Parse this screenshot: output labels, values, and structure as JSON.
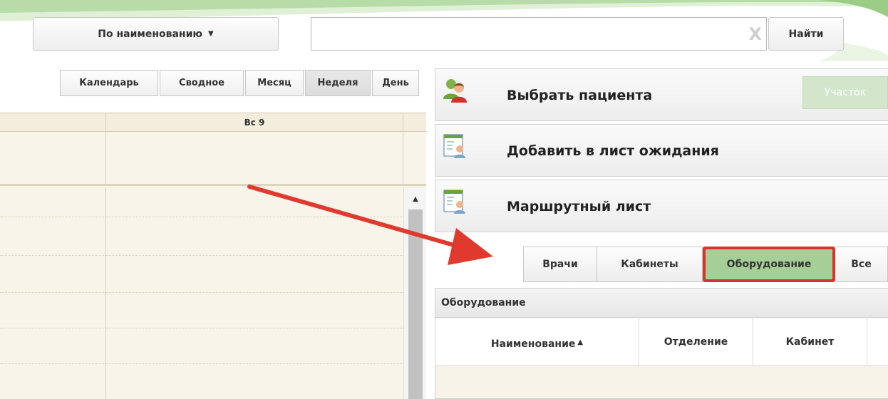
{
  "toolbar": {
    "search_by_label": "По наименованию",
    "search_placeholder": "",
    "search_value": "",
    "find_label": "Найти"
  },
  "calendar": {
    "views": [
      "Календарь",
      "Сводное"
    ],
    "periods": [
      "Месяц",
      "Неделя",
      "День"
    ],
    "active_period": "Неделя",
    "day_header": "Вс 9"
  },
  "actions": {
    "select_patient": "Выбрать пациента",
    "uchastok": "Участок",
    "add_waitlist": "Добавить в лист ожидания",
    "route_sheet": "Маршрутный лист"
  },
  "filters": {
    "tabs": [
      "Врачи",
      "Кабинеты",
      "Оборудование",
      "Все"
    ],
    "active": "Оборудование"
  },
  "equipment": {
    "title": "Оборудование",
    "columns": [
      "Наименование",
      "Отделение",
      "Кабинет"
    ]
  },
  "colors": {
    "active_tab": "#a5cf96",
    "highlight": "#d9332c",
    "calendar_bg": "#f7f3e8",
    "uchastok_bg": "#d3e6cc"
  }
}
